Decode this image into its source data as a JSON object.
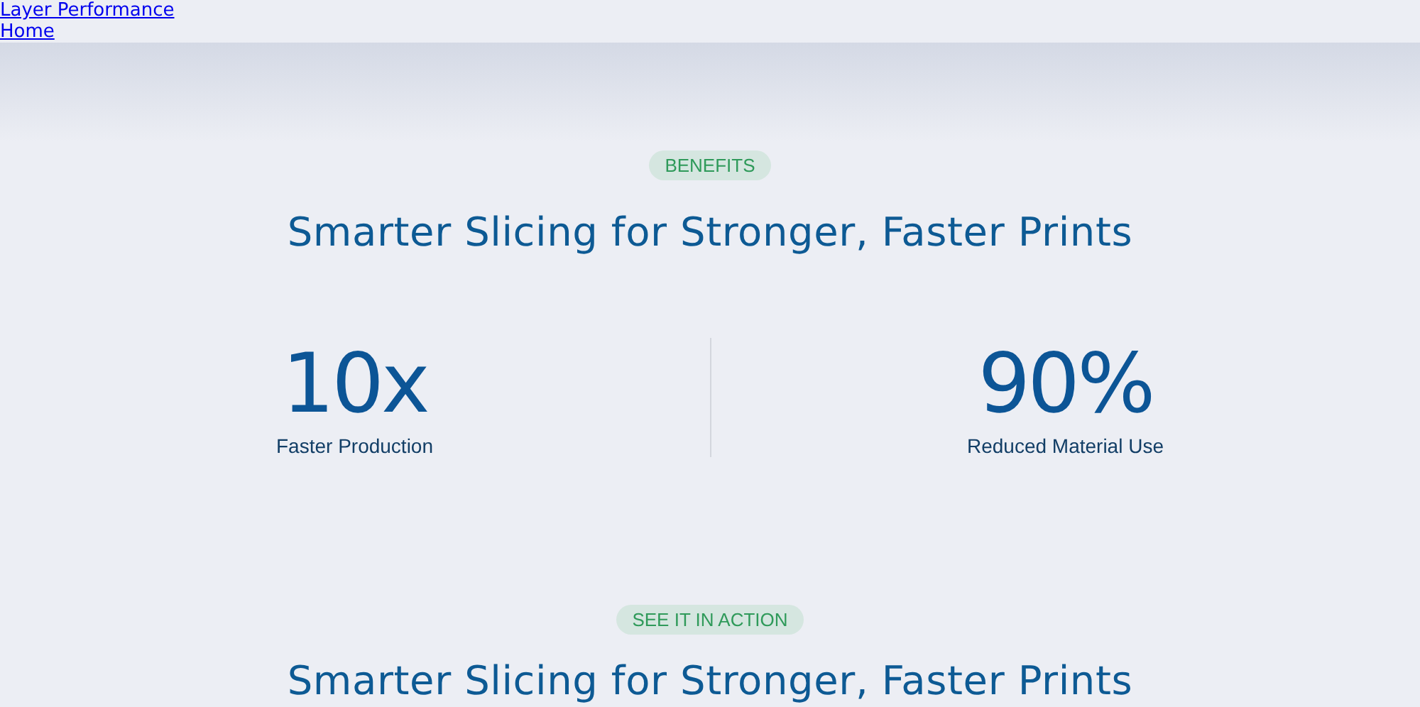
{
  "nav_links": [
    "Layer Performance",
    "Home"
  ],
  "sections": [
    {
      "badge": "BENEFITS",
      "heading": "Smarter Slicing for Stronger, Faster Prints",
      "stats": [
        {
          "value": "10x",
          "label": "Faster Production"
        },
        {
          "value": "90%",
          "label": "Reduced Material Use"
        }
      ]
    },
    {
      "badge": "SEE IT IN ACTION",
      "heading": "Smarter Slicing for Stronger, Faster Prints"
    }
  ]
}
